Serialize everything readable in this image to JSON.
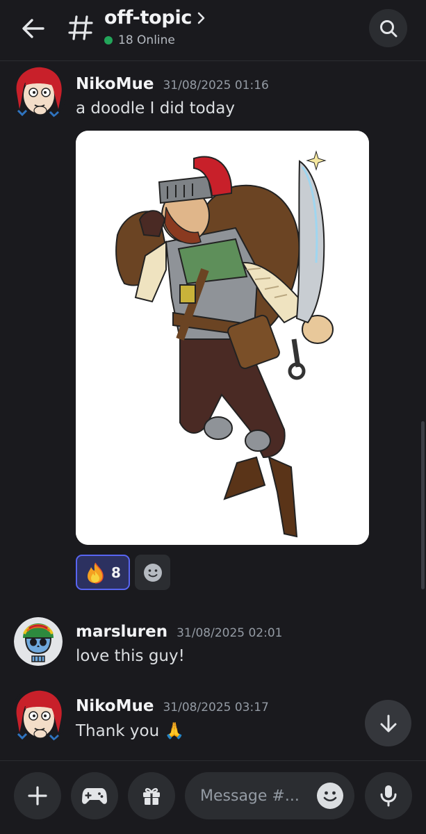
{
  "header": {
    "channel_name": "off-topic",
    "online": "18 Online"
  },
  "messages": [
    {
      "author": "NikoMue",
      "timestamp": "31/08/2025 01:16",
      "text": "a doodle I did today",
      "reaction": {
        "emoji": "fire",
        "count": "8"
      }
    },
    {
      "author": "marsluren",
      "timestamp": "31/08/2025 02:01",
      "text": "love this guy!"
    },
    {
      "author": "NikoMue",
      "timestamp": "31/08/2025 03:17",
      "text": "Thank you 🙏"
    }
  ],
  "composer": {
    "placeholder": "Message #..."
  },
  "colors": {
    "background": "#1a1a1e",
    "accent": "#5865f2",
    "online": "#23a55a"
  },
  "icons": [
    "back-arrow-icon",
    "hash-icon",
    "chevron-right-icon",
    "search-icon",
    "smile-icon",
    "arrow-down-icon",
    "plus-icon",
    "gamepad-icon",
    "gift-icon",
    "microphone-icon"
  ]
}
